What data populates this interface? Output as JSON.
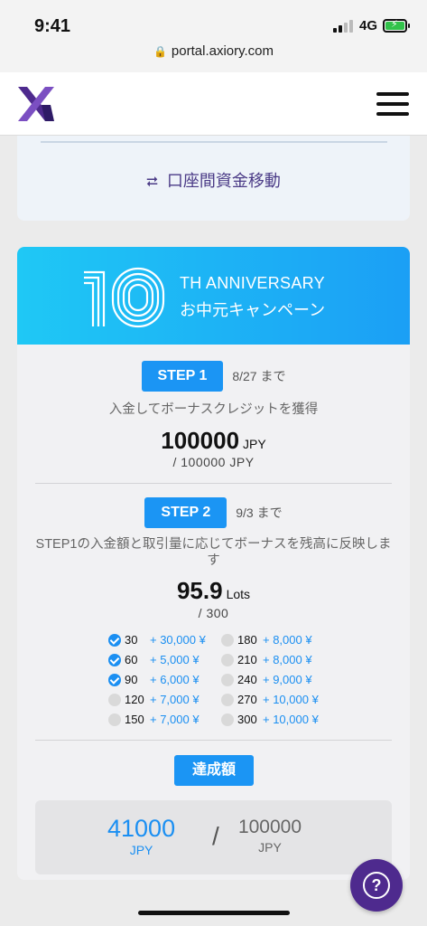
{
  "status": {
    "time": "9:41",
    "network": "4G",
    "url": "portal.axiory.com"
  },
  "header": {
    "logo": "X"
  },
  "transfer": {
    "icon": "⮂",
    "label": "口座間資金移動"
  },
  "banner": {
    "number": "10",
    "title": "TH ANNIVERSARY",
    "subtitle": "お中元キャンペーン"
  },
  "step1": {
    "label": "STEP 1",
    "deadline": "8/27 まで",
    "description": "入金してボーナスクレジットを獲得",
    "value": "100000",
    "unit": "JPY",
    "target": "/ 100000 JPY"
  },
  "step2": {
    "label": "STEP 2",
    "deadline": "9/3 まで",
    "description": "STEP1の入金額と取引量に応じてボーナスを残高に反映します",
    "value": "95.9",
    "unit": "Lots",
    "target": "/ 300"
  },
  "tiers": [
    {
      "lots": "30",
      "bonus": "+ 30,000 ¥",
      "done": true
    },
    {
      "lots": "60",
      "bonus": "+ 5,000 ¥",
      "done": true
    },
    {
      "lots": "90",
      "bonus": "+ 6,000 ¥",
      "done": true
    },
    {
      "lots": "120",
      "bonus": "+ 7,000 ¥",
      "done": false
    },
    {
      "lots": "150",
      "bonus": "+ 7,000 ¥",
      "done": false
    },
    {
      "lots": "180",
      "bonus": "+ 8,000 ¥",
      "done": false
    },
    {
      "lots": "210",
      "bonus": "+ 8,000 ¥",
      "done": false
    },
    {
      "lots": "240",
      "bonus": "+ 9,000 ¥",
      "done": false
    },
    {
      "lots": "270",
      "bonus": "+ 10,000 ¥",
      "done": false
    },
    {
      "lots": "300",
      "bonus": "+ 10,000 ¥",
      "done": false
    }
  ],
  "achievement": {
    "label": "達成額",
    "amount": "41000",
    "amount_unit": "JPY",
    "separator": "/",
    "max": "100000",
    "max_unit": "JPY"
  },
  "help": {
    "icon": "?"
  },
  "colors": {
    "accent": "#1b95f4",
    "brand": "#4e2a8e",
    "banner_start": "#1fc8f5",
    "banner_end": "#1b9ff5"
  }
}
